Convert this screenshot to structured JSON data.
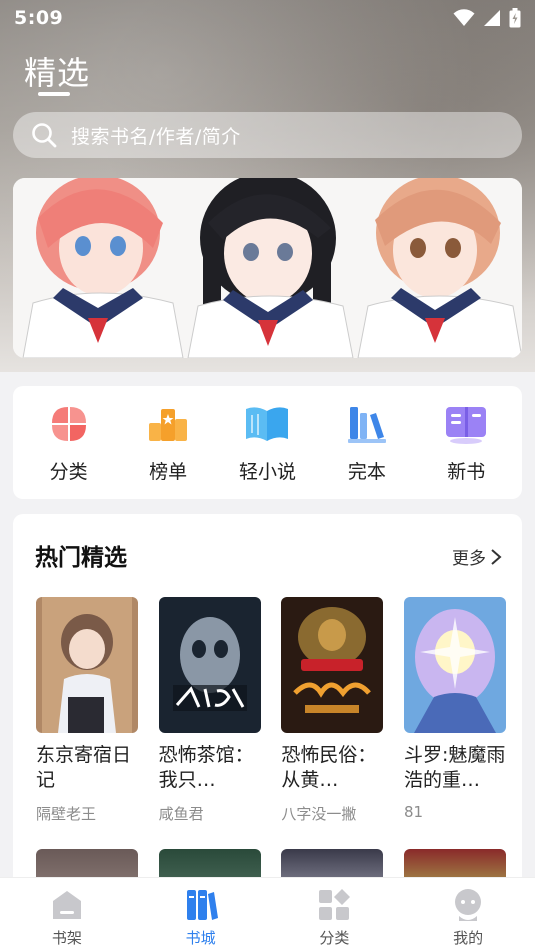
{
  "status_bar": {
    "time": "5:09"
  },
  "header": {
    "title": "精选"
  },
  "search": {
    "placeholder": "搜索书名/作者/简介"
  },
  "categories": [
    {
      "label": "分类",
      "icon": "grid-petals-icon",
      "color": "#f26d6d"
    },
    {
      "label": "榜单",
      "icon": "ranking-icon",
      "color": "#f59a2a"
    },
    {
      "label": "轻小说",
      "icon": "open-book-icon",
      "color": "#3aa6ee"
    },
    {
      "label": "完本",
      "icon": "books-stack-icon",
      "color": "#3e86e8"
    },
    {
      "label": "新书",
      "icon": "new-book-icon",
      "color": "#8a6cf0"
    }
  ],
  "hot": {
    "title": "热门精选",
    "more_label": "更多",
    "books": [
      {
        "title": "东京寄宿日记",
        "author": "隔壁老王"
      },
      {
        "title": "恐怖茶馆：我只…",
        "author": "咸鱼君"
      },
      {
        "title": "恐怖民俗：从黄…",
        "author": "八字没一撇"
      },
      {
        "title": "斗罗:魅魔雨浩的重…",
        "author": "81"
      }
    ]
  },
  "bottom_nav": [
    {
      "label": "书架",
      "icon": "bookshelf-icon",
      "active": false
    },
    {
      "label": "书城",
      "icon": "bookstore-icon",
      "active": true
    },
    {
      "label": "分类",
      "icon": "category-icon",
      "active": false
    },
    {
      "label": "我的",
      "icon": "profile-icon",
      "active": false
    }
  ],
  "colors": {
    "accent": "#2f80ed",
    "background": "#f2f2f4"
  }
}
